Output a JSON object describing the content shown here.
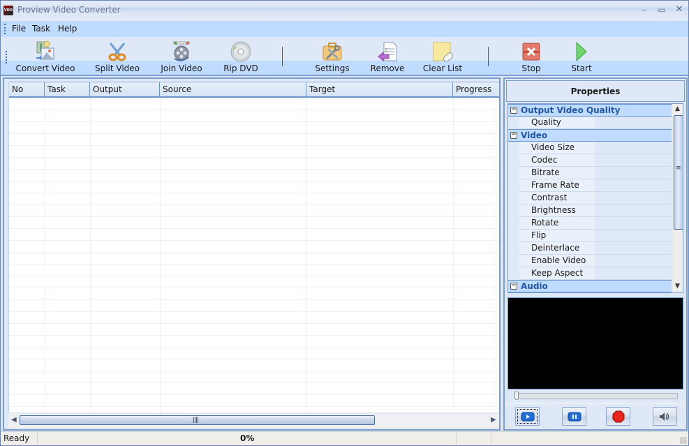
{
  "window": {
    "title": "Proview Video Converter",
    "app_icon_text": "VDO",
    "controls": {
      "minimize": "–",
      "maximize": "▭",
      "close": "✕"
    }
  },
  "menubar": {
    "items": [
      {
        "label": "File"
      },
      {
        "label": "Task"
      },
      {
        "label": "Help"
      }
    ]
  },
  "toolbar": {
    "buttons": [
      {
        "label": "Convert Video",
        "icon": "convert-video-icon"
      },
      {
        "label": "Split Video",
        "icon": "scissors-icon"
      },
      {
        "label": "Join Video",
        "icon": "film-reel-icon"
      },
      {
        "label": "Rip DVD",
        "icon": "dvd-disc-icon"
      },
      {
        "label": "Settings",
        "icon": "settings-tools-icon"
      },
      {
        "label": "Remove",
        "icon": "remove-document-icon"
      },
      {
        "label": "Clear List",
        "icon": "clear-list-eraser-icon"
      },
      {
        "label": "Stop",
        "icon": "stop-x-icon"
      },
      {
        "label": "Start",
        "icon": "play-triangle-icon"
      }
    ]
  },
  "task_list": {
    "columns": [
      "No",
      "Task",
      "Output",
      "Source",
      "Target",
      "Progress"
    ],
    "rows": []
  },
  "properties": {
    "title": "Properties",
    "categories": [
      {
        "label": "Output Video Quality",
        "toggle": "−",
        "items": [
          "Quality"
        ]
      },
      {
        "label": "Video",
        "toggle": "−",
        "items": [
          "Video Size",
          "Codec",
          "Bitrate",
          "Frame Rate",
          "Contrast",
          "Brightness",
          "Rotate",
          "Flip",
          "Deinterlace",
          "Enable Video",
          "Keep Aspect"
        ]
      },
      {
        "label": "Audio",
        "toggle": "−",
        "items": []
      }
    ]
  },
  "player": {
    "seek_position": 0,
    "buttons": [
      {
        "name": "play",
        "icon": "play-icon"
      },
      {
        "name": "pause",
        "icon": "pause-icon"
      },
      {
        "name": "stop",
        "icon": "stop-octagon-icon"
      },
      {
        "name": "volume",
        "icon": "speaker-icon"
      }
    ]
  },
  "statusbar": {
    "status": "Ready",
    "progress_text": "0%"
  }
}
